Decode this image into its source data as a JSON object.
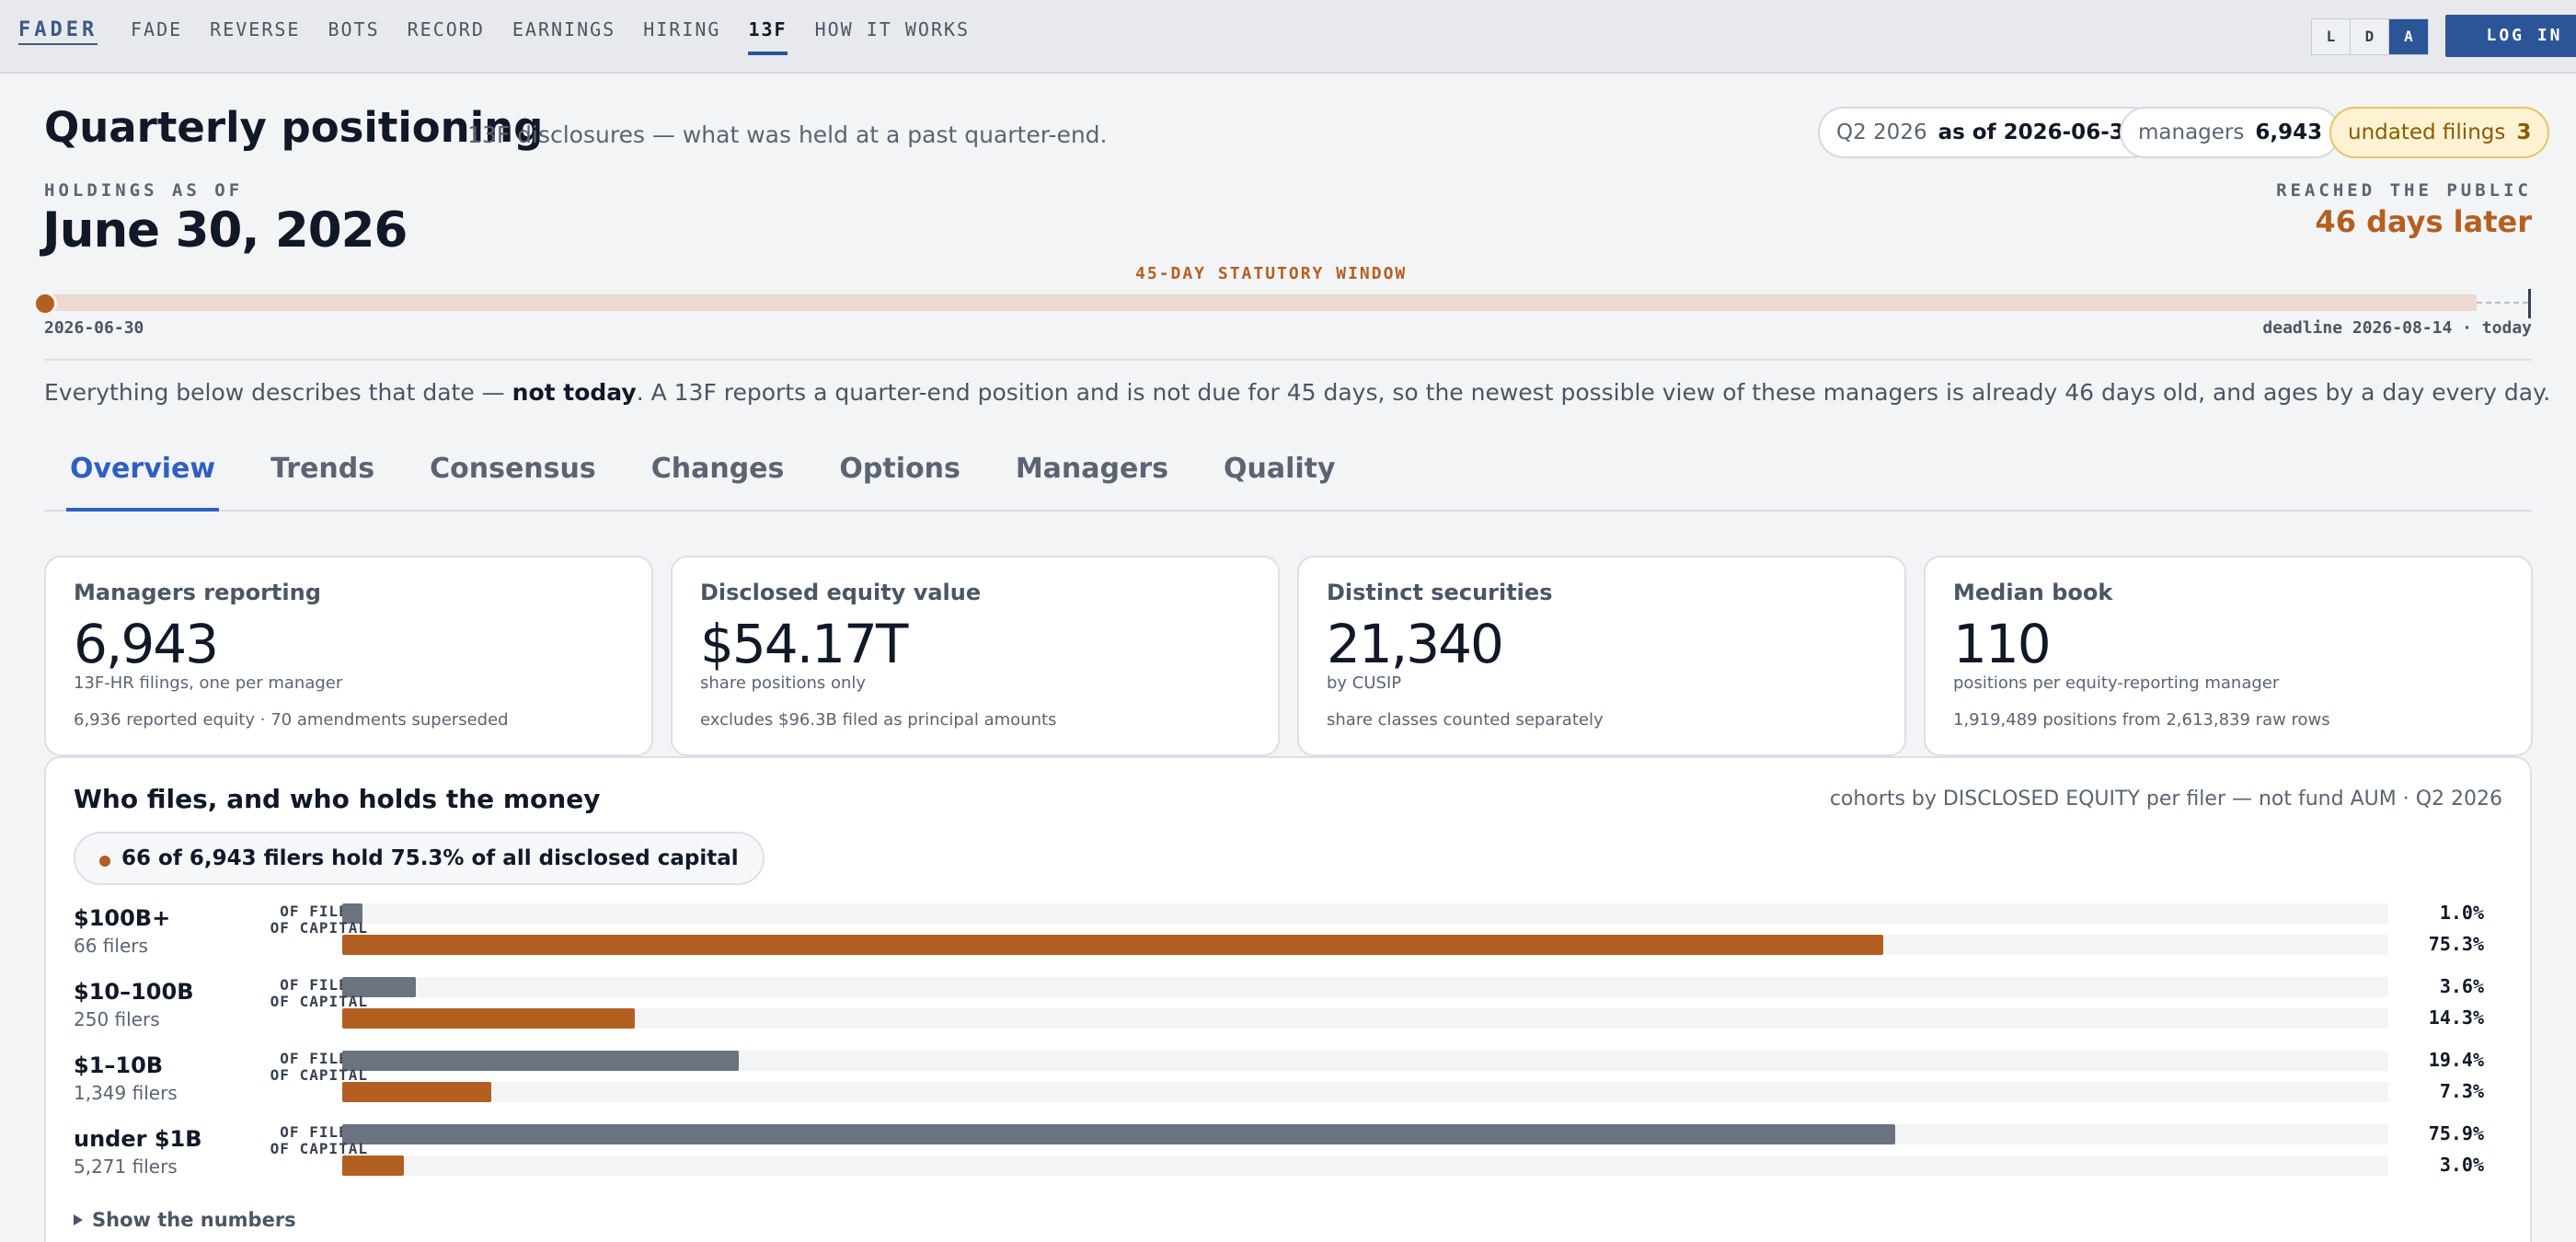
{
  "brand": "FADER",
  "nav": [
    {
      "label": "FADE",
      "active": false
    },
    {
      "label": "REVERSE",
      "active": false
    },
    {
      "label": "BOTS",
      "active": false
    },
    {
      "label": "RECORD",
      "active": false
    },
    {
      "label": "EARNINGS",
      "active": false
    },
    {
      "label": "HIRING",
      "active": false
    },
    {
      "label": "13F",
      "active": true
    },
    {
      "label": "HOW IT WORKS",
      "active": false
    }
  ],
  "theme_toggle": {
    "options": [
      "L",
      "D",
      "A"
    ],
    "selected": "A"
  },
  "login_label": "LOG IN",
  "header": {
    "title": "Quarterly positioning",
    "subtitle": "13F disclosures — what was held at a past quarter-end.",
    "pills": {
      "quarter_key": "Q2 2026",
      "quarter_value": "as of 2026-06-30",
      "managers_key": "managers",
      "managers_value": "6,943",
      "undated_key": "undated filings",
      "undated_value": "3"
    }
  },
  "asof": {
    "label": "HOLDINGS AS OF",
    "date": "June 30, 2026",
    "reached_label": "REACHED THE PUBLIC",
    "reached_value": "46 days later"
  },
  "timeline": {
    "window_label": "45-DAY STATUTORY WINDOW",
    "start_label": "2026-06-30",
    "end_label": "deadline 2026-08-14 · today",
    "window_days": 45,
    "days_elapsed": 46
  },
  "note": {
    "pre": "Everything below describes that date — ",
    "bold": "not today",
    "post": ". A 13F reports a quarter-end position and is not due for 45 days, so the newest possible view of these managers is already 46 days old, and ages by a day every day."
  },
  "tabs": [
    {
      "label": "Overview",
      "active": true
    },
    {
      "label": "Trends",
      "active": false
    },
    {
      "label": "Consensus",
      "active": false
    },
    {
      "label": "Changes",
      "active": false
    },
    {
      "label": "Options",
      "active": false
    },
    {
      "label": "Managers",
      "active": false
    },
    {
      "label": "Quality",
      "active": false
    }
  ],
  "stats": [
    {
      "title": "Managers reporting",
      "value": "6,943",
      "sub": "13F-HR filings, one per manager",
      "foot": "6,936 reported equity · 70 amendments superseded"
    },
    {
      "title": "Disclosed equity value",
      "value": "$54.17T",
      "sub": "share positions only",
      "foot": "excludes $96.3B filed as principal amounts"
    },
    {
      "title": "Distinct securities",
      "value": "21,340",
      "sub": "by CUSIP",
      "foot": "share classes counted separately"
    },
    {
      "title": "Median book",
      "value": "110",
      "sub": "positions per equity-reporting manager",
      "foot": "1,919,489 positions from 2,613,839 raw rows"
    }
  ],
  "cohorts": {
    "title": "Who files, and who holds the money",
    "note": "cohorts by DISCLOSED EQUITY per filer — not fund AUM · Q2 2026",
    "callout": "66 of 6,943 filers hold 75.3% of all disclosed capital",
    "filers_label": "OF FILERS",
    "capital_label": "OF CAPITAL",
    "show_numbers": "Show the numbers",
    "colors": {
      "filers": "#6b7280",
      "capital": "#b45f22"
    }
  },
  "chart_data": {
    "type": "bar",
    "categories": [
      "$100B+",
      "$10–100B",
      "$1–10B",
      "under $1B"
    ],
    "category_counts": [
      "66 filers",
      "250 filers",
      "1,349 filers",
      "5,271 filers"
    ],
    "series": [
      {
        "name": "OF FILERS",
        "values": [
          1.0,
          3.6,
          19.4,
          75.9
        ],
        "labels": [
          "1.0%",
          "3.6%",
          "19.4%",
          "75.9%"
        ]
      },
      {
        "name": "OF CAPITAL",
        "values": [
          75.3,
          14.3,
          7.3,
          3.0
        ],
        "labels": [
          "75.3%",
          "14.3%",
          "7.3%",
          "3.0%"
        ]
      }
    ],
    "xlim": [
      0,
      100
    ]
  }
}
